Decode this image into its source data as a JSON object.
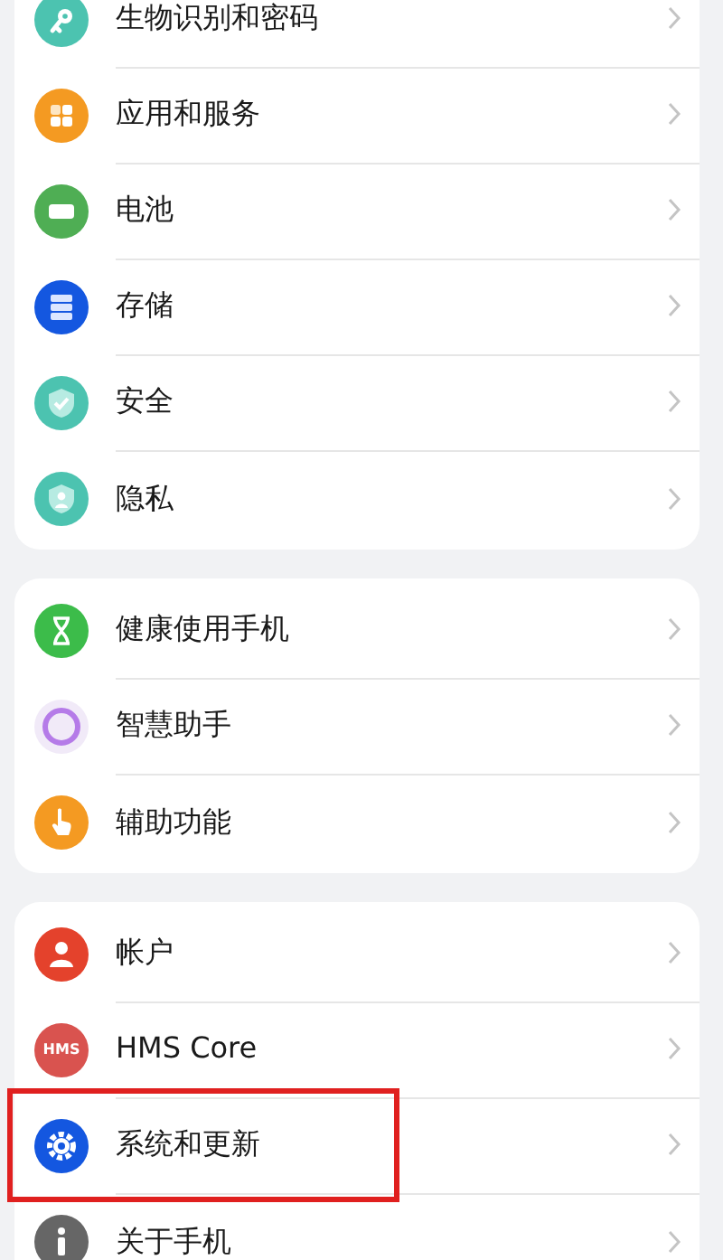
{
  "groups": [
    {
      "items": [
        {
          "label": "生物识别和密码",
          "kind": "key",
          "color": "#4cc3b0",
          "highlighted": false
        },
        {
          "label": "应用和服务",
          "kind": "grid",
          "color": "#f49a22",
          "highlighted": false
        },
        {
          "label": "电池",
          "kind": "battery",
          "color": "#4fae54",
          "highlighted": false
        },
        {
          "label": "存储",
          "kind": "storage",
          "color": "#1457e0",
          "highlighted": false
        },
        {
          "label": "安全",
          "kind": "shield-check",
          "color": "#4cc3b0",
          "highlighted": false
        },
        {
          "label": "隐私",
          "kind": "shield-person",
          "color": "#4cc3b0",
          "highlighted": false
        }
      ]
    },
    {
      "items": [
        {
          "label": "健康使用手机",
          "kind": "hourglass",
          "color": "#3cbc4a",
          "highlighted": false
        },
        {
          "label": "智慧助手",
          "kind": "ring",
          "color": "#b57be8",
          "highlighted": false
        },
        {
          "label": "辅助功能",
          "kind": "hand",
          "color": "#f49a22",
          "highlighted": false
        }
      ]
    },
    {
      "items": [
        {
          "label": "帐户",
          "kind": "person",
          "color": "#e4422c",
          "highlighted": false
        },
        {
          "label": "HMS Core",
          "kind": "hms",
          "color": "#d9534f",
          "icon_text": "HMS",
          "highlighted": false
        },
        {
          "label": "系统和更新",
          "kind": "gear",
          "color": "#1457e0",
          "highlighted": true
        },
        {
          "label": "关于手机",
          "kind": "info",
          "color": "#666666",
          "highlighted": false
        }
      ]
    }
  ]
}
